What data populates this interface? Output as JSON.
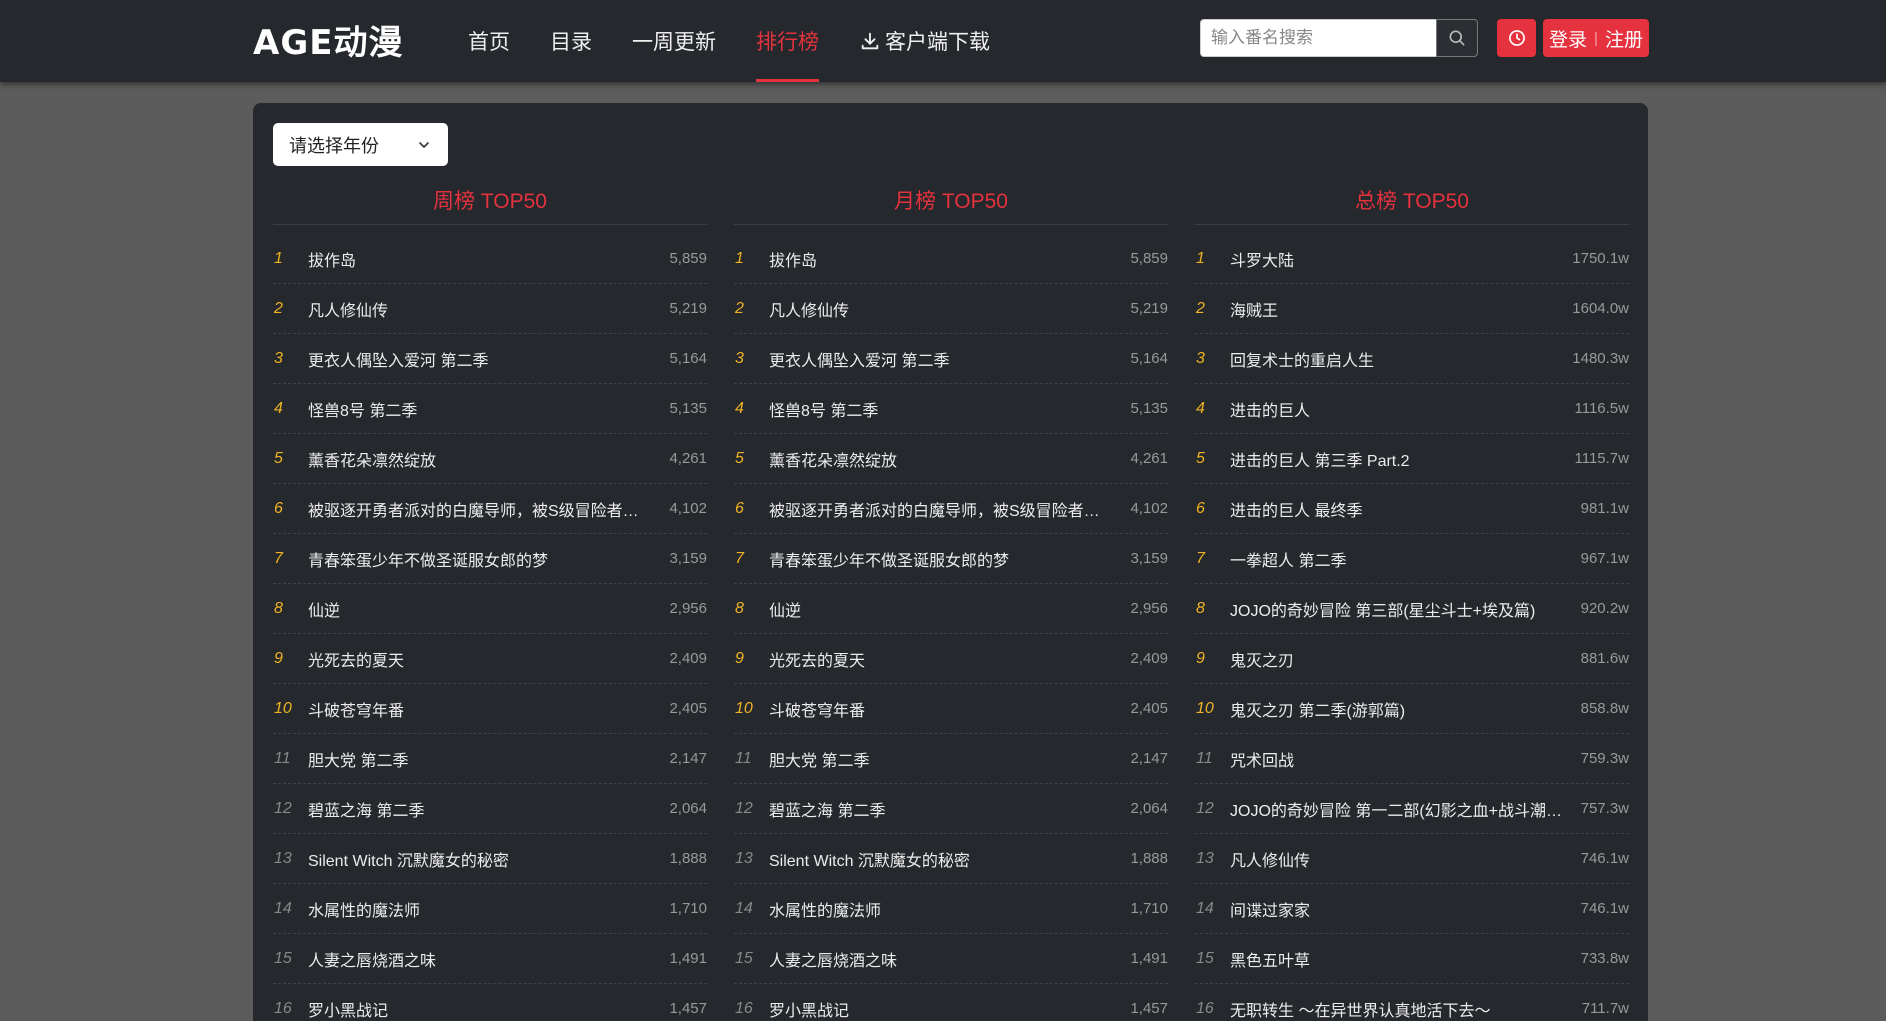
{
  "header": {
    "logo_text": "AGE动漫",
    "nav": [
      {
        "label": "首页",
        "active": false
      },
      {
        "label": "目录",
        "active": false
      },
      {
        "label": "一周更新",
        "active": false
      },
      {
        "label": "排行榜",
        "active": true
      },
      {
        "label": "客户端下载",
        "active": false,
        "icon": "download-icon"
      }
    ],
    "search_placeholder": "输入番名搜索",
    "login_label": "登录",
    "register_label": "注册",
    "accent_color": "#e5323e"
  },
  "filter": {
    "year_select_label": "请选择年份"
  },
  "weekly": {
    "title": "周榜 TOP50",
    "items": [
      {
        "rank": "1",
        "name": "拔作岛",
        "count": "5,859"
      },
      {
        "rank": "2",
        "name": "凡人修仙传",
        "count": "5,219"
      },
      {
        "rank": "3",
        "name": "更衣人偶坠入爱河 第二季",
        "count": "5,164"
      },
      {
        "rank": "4",
        "name": "怪兽8号 第二季",
        "count": "5,135"
      },
      {
        "rank": "5",
        "name": "薰香花朵凛然绽放",
        "count": "4,261"
      },
      {
        "rank": "6",
        "name": "被驱逐开勇者派对的白魔导师，被S级冒险者…",
        "count": "4,102"
      },
      {
        "rank": "7",
        "name": "青春笨蛋少年不做圣诞服女郎的梦",
        "count": "3,159"
      },
      {
        "rank": "8",
        "name": "仙逆",
        "count": "2,956"
      },
      {
        "rank": "9",
        "name": "光死去的夏天",
        "count": "2,409"
      },
      {
        "rank": "10",
        "name": "斗破苍穹年番",
        "count": "2,405"
      },
      {
        "rank": "11",
        "name": "胆大党 第二季",
        "count": "2,147"
      },
      {
        "rank": "12",
        "name": "碧蓝之海 第二季",
        "count": "2,064"
      },
      {
        "rank": "13",
        "name": "Silent Witch 沉默魔女的秘密",
        "count": "1,888"
      },
      {
        "rank": "14",
        "name": "水属性的魔法师",
        "count": "1,710"
      },
      {
        "rank": "15",
        "name": "人妻之唇烧酒之味",
        "count": "1,491"
      },
      {
        "rank": "16",
        "name": "罗小黑战记",
        "count": "1,457"
      }
    ]
  },
  "monthly": {
    "title": "月榜 TOP50",
    "items": [
      {
        "rank": "1",
        "name": "拔作岛",
        "count": "5,859"
      },
      {
        "rank": "2",
        "name": "凡人修仙传",
        "count": "5,219"
      },
      {
        "rank": "3",
        "name": "更衣人偶坠入爱河 第二季",
        "count": "5,164"
      },
      {
        "rank": "4",
        "name": "怪兽8号 第二季",
        "count": "5,135"
      },
      {
        "rank": "5",
        "name": "薰香花朵凛然绽放",
        "count": "4,261"
      },
      {
        "rank": "6",
        "name": "被驱逐开勇者派对的白魔导师，被S级冒险者…",
        "count": "4,102"
      },
      {
        "rank": "7",
        "name": "青春笨蛋少年不做圣诞服女郎的梦",
        "count": "3,159"
      },
      {
        "rank": "8",
        "name": "仙逆",
        "count": "2,956"
      },
      {
        "rank": "9",
        "name": "光死去的夏天",
        "count": "2,409"
      },
      {
        "rank": "10",
        "name": "斗破苍穹年番",
        "count": "2,405"
      },
      {
        "rank": "11",
        "name": "胆大党 第二季",
        "count": "2,147"
      },
      {
        "rank": "12",
        "name": "碧蓝之海 第二季",
        "count": "2,064"
      },
      {
        "rank": "13",
        "name": "Silent Witch 沉默魔女的秘密",
        "count": "1,888"
      },
      {
        "rank": "14",
        "name": "水属性的魔法师",
        "count": "1,710"
      },
      {
        "rank": "15",
        "name": "人妻之唇烧酒之味",
        "count": "1,491"
      },
      {
        "rank": "16",
        "name": "罗小黑战记",
        "count": "1,457"
      }
    ]
  },
  "total": {
    "title": "总榜 TOP50",
    "items": [
      {
        "rank": "1",
        "name": "斗罗大陆",
        "count": "1750.1w"
      },
      {
        "rank": "2",
        "name": "海贼王",
        "count": "1604.0w"
      },
      {
        "rank": "3",
        "name": "回复术士的重启人生",
        "count": "1480.3w"
      },
      {
        "rank": "4",
        "name": "进击的巨人",
        "count": "1116.5w"
      },
      {
        "rank": "5",
        "name": "进击的巨人 第三季 Part.2",
        "count": "1115.7w"
      },
      {
        "rank": "6",
        "name": "进击的巨人 最终季",
        "count": "981.1w"
      },
      {
        "rank": "7",
        "name": "一拳超人 第二季",
        "count": "967.1w"
      },
      {
        "rank": "8",
        "name": "JOJO的奇妙冒险 第三部(星尘斗士+埃及篇)",
        "count": "920.2w"
      },
      {
        "rank": "9",
        "name": "鬼灭之刃",
        "count": "881.6w"
      },
      {
        "rank": "10",
        "name": "鬼灭之刃 第二季(游郭篇)",
        "count": "858.8w"
      },
      {
        "rank": "11",
        "name": "咒术回战",
        "count": "759.3w"
      },
      {
        "rank": "12",
        "name": "JOJO的奇妙冒险 第一二部(幻影之血+战斗潮…",
        "count": "757.3w"
      },
      {
        "rank": "13",
        "name": "凡人修仙传",
        "count": "746.1w"
      },
      {
        "rank": "14",
        "name": "间谍过家家",
        "count": "746.1w"
      },
      {
        "rank": "15",
        "name": "黑色五叶草",
        "count": "733.8w"
      },
      {
        "rank": "16",
        "name": "无职转生 ～在异世界认真地活下去～",
        "count": "711.7w"
      }
    ]
  }
}
